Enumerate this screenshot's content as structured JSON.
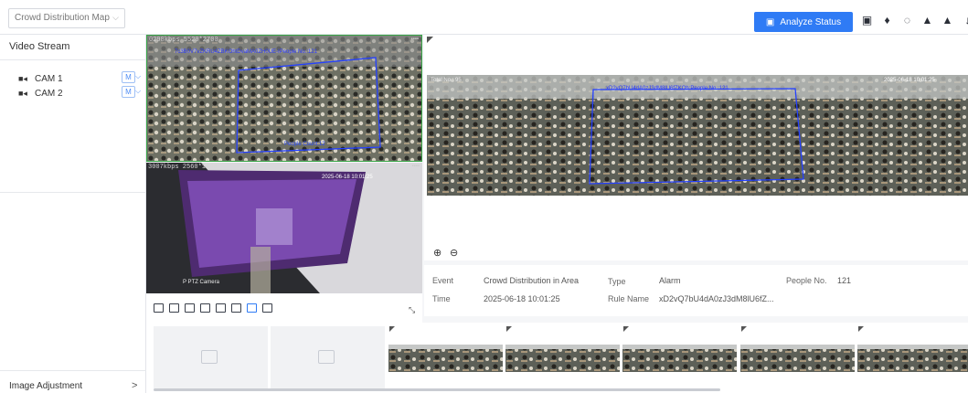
{
  "header": {
    "mode_select": "Crowd Distribution Map",
    "analyze_button": "Analyze Status",
    "toolbar_icons": [
      "snapshot-icon",
      "alarm-icon",
      "cloud-icon",
      "record-icon",
      "record-icon",
      "audio-icon"
    ]
  },
  "sidebar": {
    "title": "Video Stream",
    "cameras": [
      {
        "label": "CAM 1",
        "tag": "M"
      },
      {
        "label": "CAM 2",
        "tag": "M"
      }
    ],
    "image_adjustment": "Image Adjustment",
    "image_adjustment_arrow": ">"
  },
  "videos": [
    {
      "stream_info": "0298kbps 5520*2700",
      "overlay": "7c3B0V7vZKRU4ZBKOhtDvaMA0ZH0UE-IPeople No.:121",
      "count": "People Count:12",
      "caption": ""
    },
    {
      "stream_info": "3007kbps 2560*1440",
      "overlay": "2025-06-18 10:01:25",
      "count": "",
      "caption": "P PTZ Camera"
    }
  ],
  "main_view": {
    "overlay_left": "Total No.: 95",
    "overlay_center": "xD2vQ7bU4dA0zJ3dM8lU6fZKOh:People No.:121",
    "overlay_right": "2025-06-18 10:01:25"
  },
  "event_info": {
    "event_label": "Event",
    "event_value": "Crowd Distribution in Area",
    "type_label": "Type",
    "type_value": "Alarm",
    "people_label": "People No.",
    "people_value": "121",
    "time_label": "Time",
    "time_value": "2025-06-18 10:01:25",
    "rule_label": "Rule Name",
    "rule_value": "xD2vQ7bU4dA0zJ3dM8lU6fZ..."
  },
  "colors": {
    "accent": "#2f7bf5",
    "video_border": "#3aa648"
  }
}
